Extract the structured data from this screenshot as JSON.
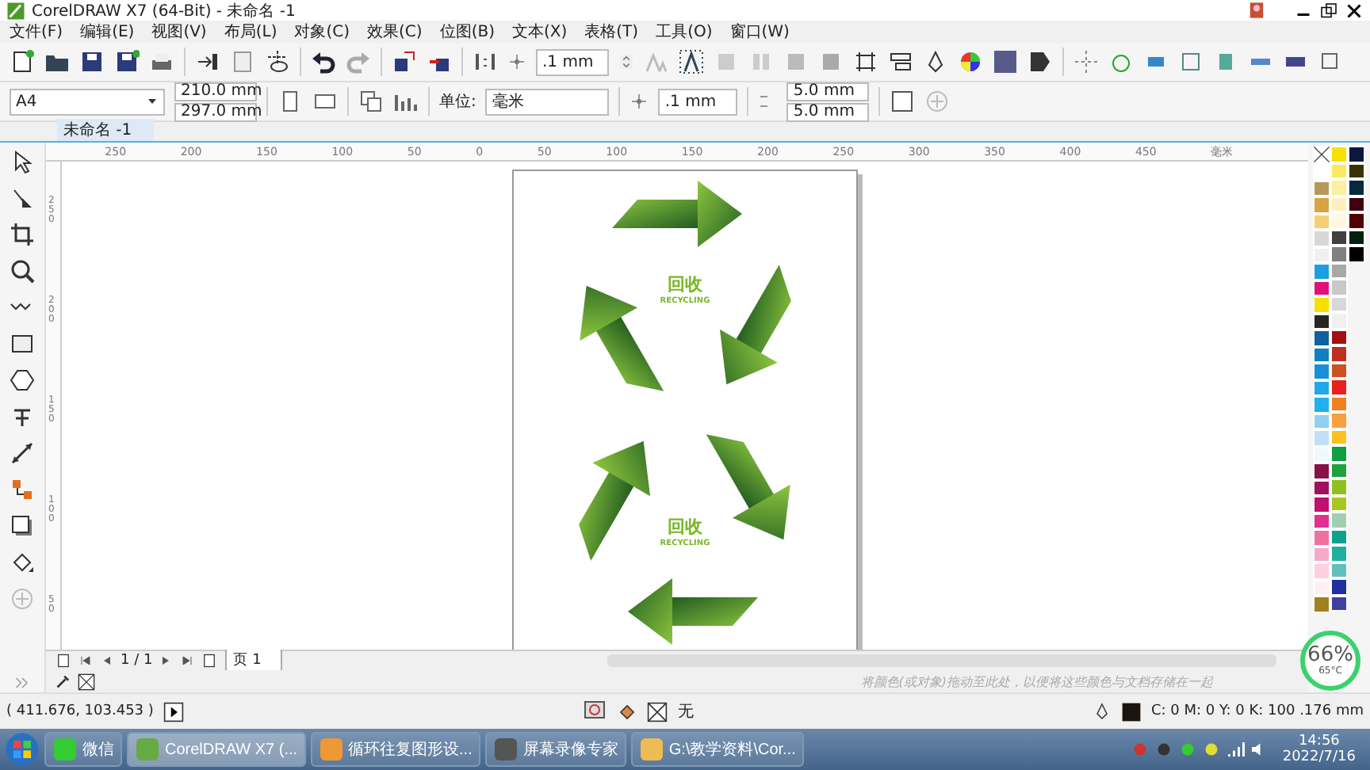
{
  "window": {
    "title": "CorelDRAW X7 (64-Bit) - 未命名 -1"
  },
  "menu": [
    "文件(F)",
    "编辑(E)",
    "视图(V)",
    "布局(L)",
    "对象(C)",
    "效果(C)",
    "位图(B)",
    "文本(X)",
    "表格(T)",
    "工具(O)",
    "窗口(W)"
  ],
  "toolbar": {
    "nudge": ".1 mm"
  },
  "property_bar": {
    "page_size": "A4",
    "width": "210.0 mm",
    "height": "297.0 mm",
    "units_label": "单位:",
    "units": "毫米",
    "nudge": ".1 mm",
    "duplicate_x": "5.0 mm",
    "duplicate_y": "5.0 mm"
  },
  "document_tabs": [
    {
      "label": "未命名 -1",
      "selected": true
    }
  ],
  "horizontal_ruler": {
    "ticks": [
      "250",
      "200",
      "150",
      "100",
      "50",
      "0",
      "50",
      "100",
      "150",
      "200",
      "250",
      "300",
      "350",
      "400",
      "450"
    ],
    "unit": "毫米"
  },
  "vertical_ruler": {
    "ticks": [
      "250",
      "200",
      "150",
      "100",
      "50"
    ]
  },
  "page": {
    "logos": [
      {
        "title": "回收",
        "subtitle": "RECYCLING"
      },
      {
        "title": "回收",
        "subtitle": "RECYCLING"
      }
    ]
  },
  "page_navigator": {
    "counter": "1 / 1",
    "pages": [
      {
        "label": "页 1",
        "selected": true
      }
    ]
  },
  "color_tray": {
    "hint": "将颜色(或对象)拖动至此处，以便将这些颜色与文档存储在一起"
  },
  "palette": {
    "columns": [
      [
        {
          "color": "#ffffff"
        },
        {
          "color": "#b8975a"
        },
        {
          "color": "#d8a440"
        },
        {
          "color": "#f5d070"
        },
        {
          "color": "#d8d8d8"
        },
        {
          "color": "#f0f0f0"
        },
        {
          "color": "#1aa0e0"
        },
        {
          "color": "#e0107a"
        },
        {
          "color": "#f5e000"
        },
        {
          "color": "#2a2420"
        },
        {
          "color": "#1060a0"
        },
        {
          "color": "#1080c0"
        },
        {
          "color": "#1890d8"
        },
        {
          "color": "#20a8e8"
        },
        {
          "color": "#20b0f0"
        },
        {
          "color": "#90d0f0"
        },
        {
          "color": "#c0e0f8"
        },
        {
          "color": "#f0f8ff"
        },
        {
          "color": "#8a1048"
        },
        {
          "color": "#a01060"
        },
        {
          "color": "#c01070"
        },
        {
          "color": "#e03090"
        },
        {
          "color": "#f070a0"
        },
        {
          "color": "#f8a8c8"
        },
        {
          "color": "#fcd0e0"
        },
        {
          "color": "#fff0f8"
        },
        {
          "color": "#a08020"
        }
      ],
      [
        {
          "color": "#f8e000"
        },
        {
          "color": "#fce860"
        },
        {
          "color": "#fcf0a0"
        },
        {
          "color": "#fcf0c0"
        },
        {
          "color": "#fff8e0"
        },
        {
          "color": "#404040"
        },
        {
          "color": "#808080"
        },
        {
          "color": "#a8a8a8"
        },
        {
          "color": "#c8c8c8"
        },
        {
          "color": "#d8d8d8"
        },
        {
          "color": "#f0f0f0"
        },
        {
          "color": "#a01010"
        },
        {
          "color": "#c03020"
        },
        {
          "color": "#d05020"
        },
        {
          "color": "#e82020"
        },
        {
          "color": "#f08020"
        },
        {
          "color": "#f8a040"
        },
        {
          "color": "#fcc020"
        },
        {
          "color": "#10a040"
        },
        {
          "color": "#20a040"
        },
        {
          "color": "#90c020"
        },
        {
          "color": "#a8c820"
        },
        {
          "color": "#a0d0b0"
        },
        {
          "color": "#10a090"
        },
        {
          "color": "#20b0a0"
        },
        {
          "color": "#60c0c0"
        },
        {
          "color": "#2030a0"
        },
        {
          "color": "#4040a0"
        }
      ],
      [
        {
          "color": "#0a1840"
        },
        {
          "color": "#3a3000"
        },
        {
          "color": "#082840"
        },
        {
          "color": "#400010"
        },
        {
          "color": "#500000"
        },
        {
          "color": "#002010"
        },
        {
          "color": "#000000"
        }
      ]
    ]
  },
  "status_bar": {
    "coordinates": "( 411.676, 103.453 )",
    "fill": "无",
    "outline": "C: 0 M: 0 Y: 0 K: 100 .176 mm"
  },
  "cpu_widget": {
    "percent": "66%",
    "temperature": "65°C"
  },
  "taskbar": {
    "tasks": [
      {
        "label": "微信",
        "selected": false
      },
      {
        "label": "CorelDRAW X7 (...",
        "selected": true
      },
      {
        "label": "循环往复图形设...",
        "selected": false
      },
      {
        "label": "屏幕录像专家",
        "selected": false
      },
      {
        "label": "G:\\教学资料\\Cor...",
        "selected": false
      }
    ],
    "time": "14:56",
    "date": "2022/7/16"
  }
}
